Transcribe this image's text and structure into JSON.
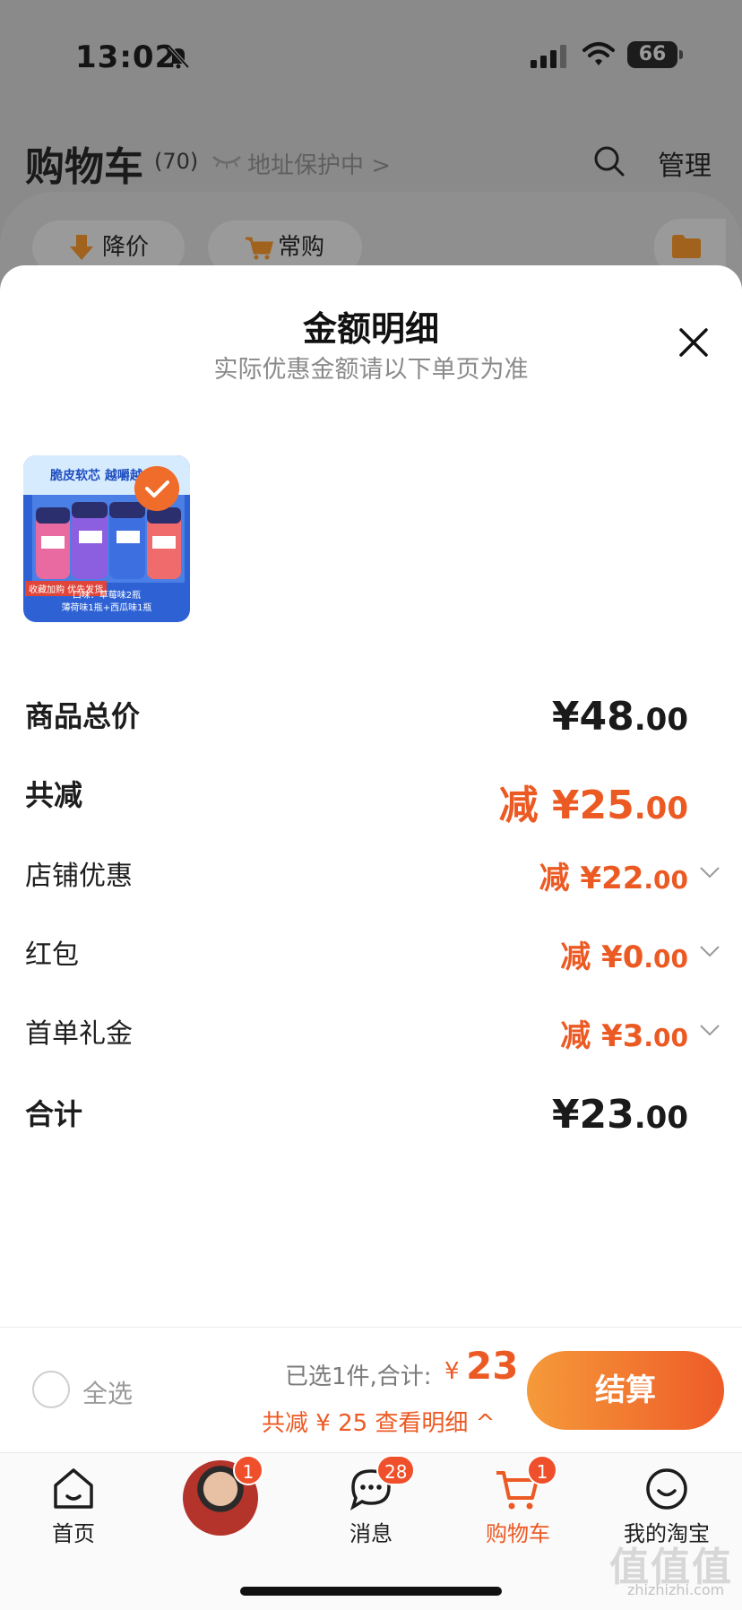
{
  "status_bar": {
    "time": "13:02",
    "battery": "66"
  },
  "cart_header": {
    "title": "购物车",
    "count": "(70)",
    "address_protect": "地址保护中 >",
    "manage": "管理"
  },
  "chips": {
    "price_drop": "降价",
    "often_bought": "常购"
  },
  "sheet": {
    "title": "金额明细",
    "subtitle": "实际优惠金额请以下单页为准"
  },
  "product": {
    "banner": "脆皮软芯 越嚼越",
    "tag": "收藏加购 优先发货",
    "caption_1": "口味：草莓味2瓶",
    "caption_2": "薄荷味1瓶+西瓜味1瓶"
  },
  "breakdown": {
    "goods_total": {
      "label": "商品总价",
      "currency": "¥",
      "int": "48",
      "dec": ".00"
    },
    "total_reduce": {
      "label": "共减",
      "prefix": "减 ¥",
      "int": "25",
      "dec": ".00"
    },
    "shop_discount": {
      "label": "店铺优惠",
      "prefix": "减 ¥",
      "int": "22",
      "dec": ".00"
    },
    "red_packet": {
      "label": "红包",
      "prefix": "减 ¥",
      "int": "0",
      "dec": ".00"
    },
    "first_order": {
      "label": "首单礼金",
      "prefix": "减 ¥",
      "int": "3",
      "dec": ".00"
    },
    "sum": {
      "label": "合计",
      "currency": "¥",
      "int": "23",
      "dec": ".00"
    }
  },
  "action_bar": {
    "select_all": "全选",
    "selected_info": "已选1件,合计:",
    "currency": "¥",
    "total": "23",
    "saving": "共减 ¥ 25  查看明细 ^",
    "checkout": "结算"
  },
  "tabbar": {
    "home": "首页",
    "avatar_badge": "1",
    "messages": "消息",
    "messages_badge": "28",
    "cart": "购物车",
    "cart_badge": "1",
    "mine": "我的淘宝"
  },
  "watermark": {
    "main": "值值值",
    "sub": "zhizhizhi.com"
  },
  "colors": {
    "accent": "#ec5a24",
    "checkout_start": "#f59a3a",
    "checkout_end": "#ee5b28"
  }
}
